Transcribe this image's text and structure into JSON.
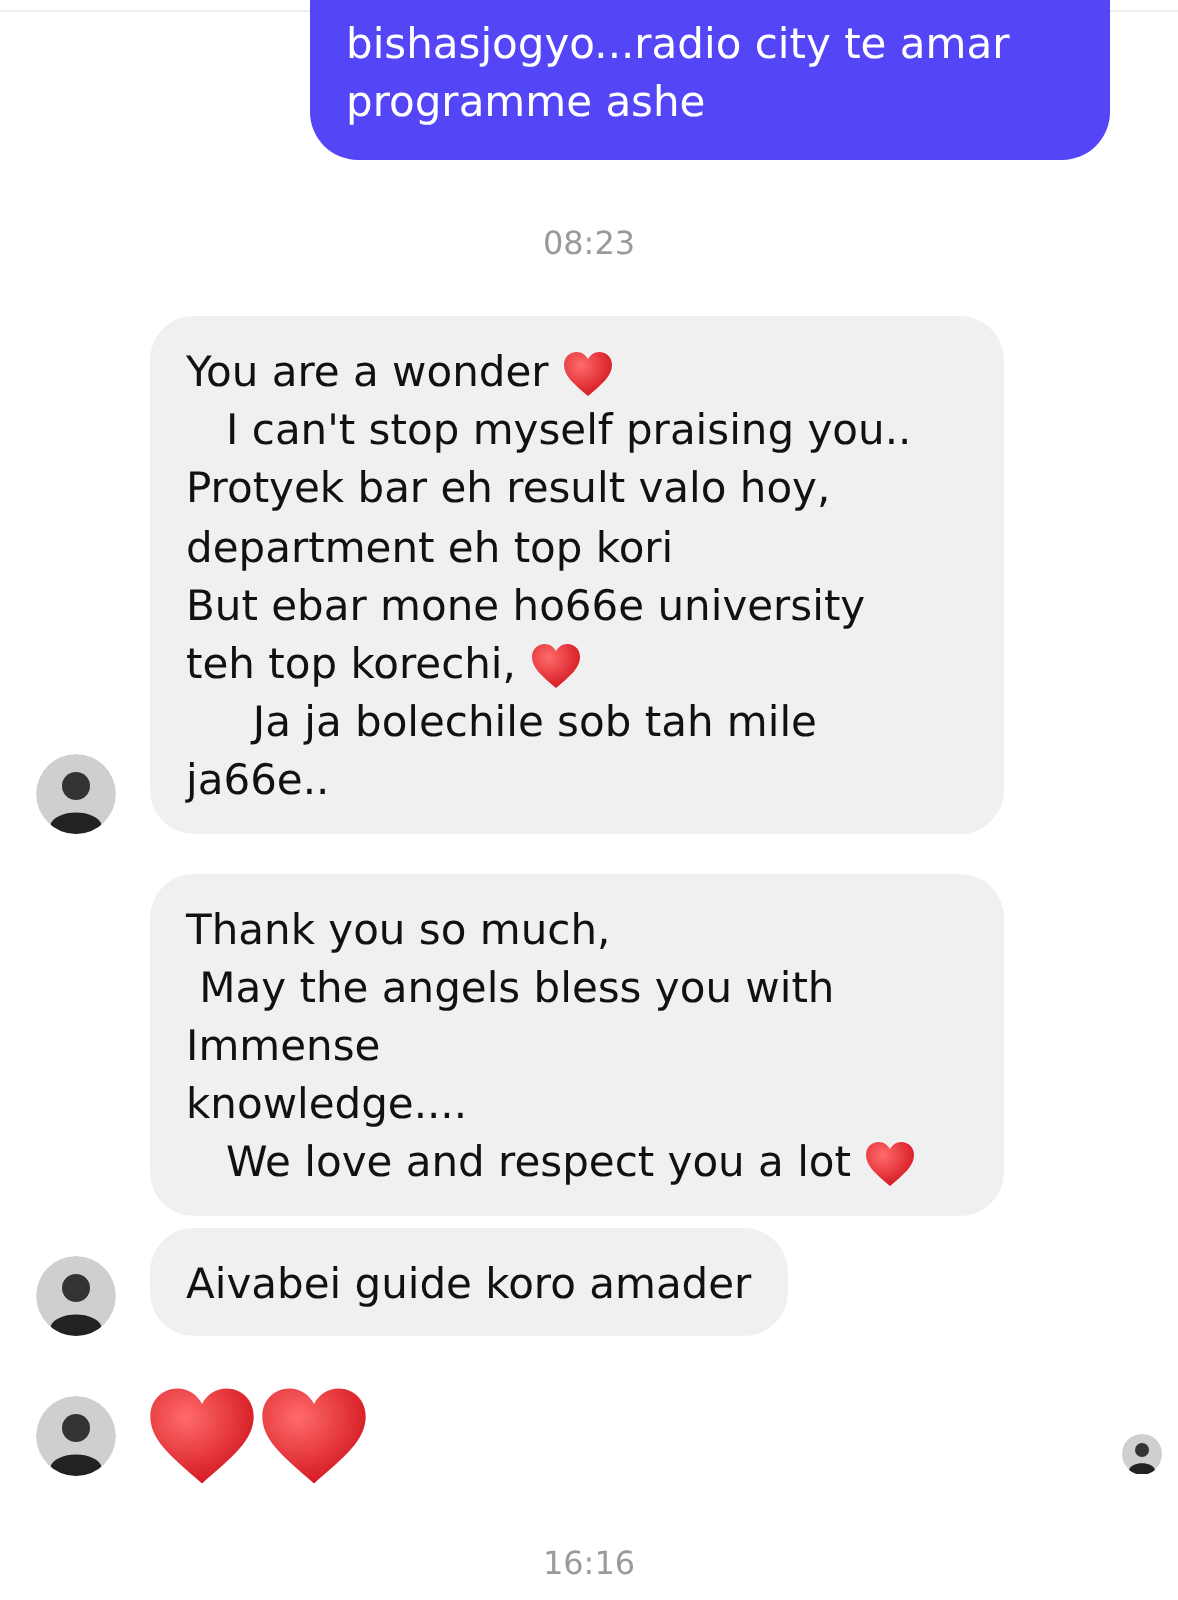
{
  "messages": [
    {
      "kind": "sent",
      "lines": [
        [
          {
            "kind": "text",
            "text": "bishasjogyo...radio city te amar"
          }
        ],
        [
          {
            "kind": "text",
            "text": "programme ashe"
          }
        ]
      ]
    },
    {
      "kind": "time",
      "text": "08:23"
    },
    {
      "kind": "received",
      "avatar": true,
      "lines": [
        [
          {
            "kind": "text",
            "text": "You are a wonder "
          },
          {
            "kind": "heart"
          }
        ],
        [
          {
            "kind": "text",
            "text": "   I can't stop myself praising you.."
          }
        ],
        [
          {
            "kind": "text",
            "text": "Protyek bar eh result valo hoy,"
          }
        ],
        [
          {
            "kind": "text",
            "text": "department eh top kori"
          }
        ],
        [
          {
            "kind": "text",
            "text": "But ebar mone ho66e university"
          }
        ],
        [
          {
            "kind": "text",
            "text": "teh top korechi, "
          },
          {
            "kind": "heart"
          }
        ],
        [
          {
            "kind": "text",
            "text": "     Ja ja bolechile sob tah mile"
          }
        ],
        [
          {
            "kind": "text",
            "text": "ja66e.."
          }
        ]
      ]
    },
    {
      "kind": "received",
      "avatar": false,
      "lines": [
        [
          {
            "kind": "text",
            "text": "Thank you so much,"
          }
        ],
        [
          {
            "kind": "text",
            "text": " May the angels bless you with"
          }
        ],
        [
          {
            "kind": "text",
            "text": "Immense"
          }
        ],
        [
          {
            "kind": "text",
            "text": "knowledge...."
          }
        ],
        [
          {
            "kind": "text",
            "text": "   We love and respect you a lot "
          },
          {
            "kind": "heart"
          }
        ]
      ]
    },
    {
      "kind": "received",
      "avatar": true,
      "lines": [
        [
          {
            "kind": "text",
            "text": "Aivabei guide koro amader"
          }
        ]
      ]
    },
    {
      "kind": "emoji",
      "avatar": true,
      "seen": true,
      "lines": [
        [
          {
            "kind": "heart"
          },
          {
            "kind": "heart"
          }
        ]
      ]
    },
    {
      "kind": "time",
      "text": "16:16"
    }
  ]
}
